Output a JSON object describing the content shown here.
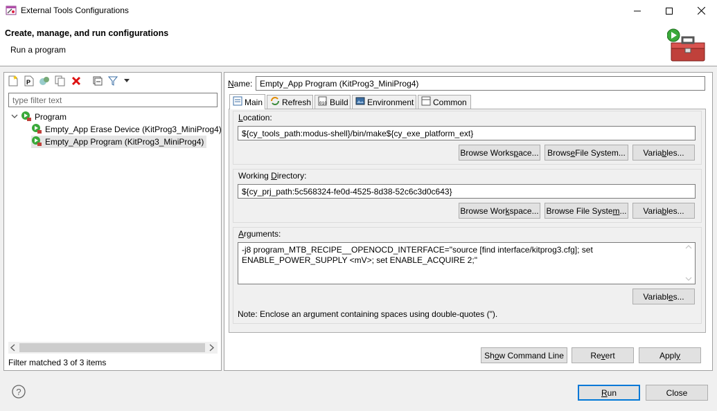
{
  "window": {
    "title": "External Tools Configurations",
    "icon": "tools-app-icon"
  },
  "banner": {
    "title": "Create, manage, and run configurations",
    "subtitle": "Run a program",
    "icon": "toolbox-run-icon"
  },
  "left": {
    "toolbar_icons": [
      "new-config-icon",
      "new-prototype-icon",
      "export-icon",
      "duplicate-icon",
      "delete-icon",
      "collapse-all-icon",
      "filter-icon",
      "view-menu-icon"
    ],
    "filter_placeholder": "type filter text",
    "tree": {
      "category": "Program",
      "items": [
        {
          "label": "Empty_App Erase Device (KitProg3_MiniProg4)",
          "selected": false
        },
        {
          "label": "Empty_App Program (KitProg3_MiniProg4)",
          "selected": true
        }
      ]
    },
    "status": "Filter matched 3 of 3 items"
  },
  "right": {
    "name_label": "Name:",
    "name_value": "Empty_App Program (KitProg3_MiniProg4)",
    "tabs": [
      {
        "label": "Main",
        "active": true
      },
      {
        "label": "Refresh",
        "active": false
      },
      {
        "label": "Build",
        "active": false
      },
      {
        "label": "Environment",
        "active": false
      },
      {
        "label": "Common",
        "active": false
      }
    ],
    "location": {
      "label": "Location:",
      "value": "${cy_tools_path:modus-shell}/bin/make${cy_exe_platform_ext}"
    },
    "working_dir": {
      "label": "Working Directory:",
      "value": "${cy_prj_path:5c568324-fe0d-4525-8d38-52c6c3d0c643}"
    },
    "arguments": {
      "label": "Arguments:",
      "value": "-j8 program_MTB_RECIPE__OPENOCD_INTERFACE=\"source [find interface/kitprog3.cfg]; set ENABLE_POWER_SUPPLY <mV>; set ENABLE_ACQUIRE 2;\"",
      "note": "Note: Enclose an argument containing spaces using double-quotes (\")."
    },
    "buttons": {
      "browse_workspace": "Browse Workspace...",
      "browse_fs": "Browse File System...",
      "variables": "Variables...",
      "show_cmd": "Show Command Line",
      "revert": "Revert",
      "apply": "Apply"
    }
  },
  "footer": {
    "run": "Run",
    "close": "Close"
  }
}
